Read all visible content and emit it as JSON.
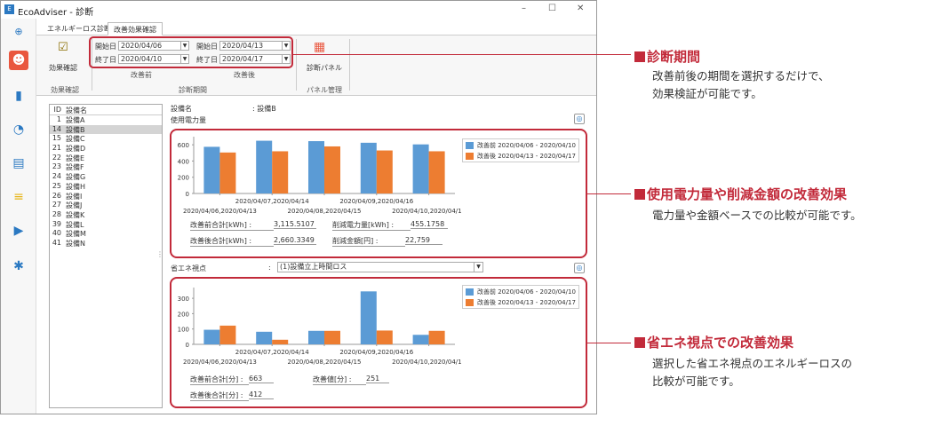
{
  "window": {
    "title": "EcoAdviser - 診断",
    "min": "–",
    "max": "☐",
    "close": "✕"
  },
  "tabs": [
    "エネルギーロス診断",
    "改善効果確認"
  ],
  "ribbon": {
    "effect_label": "効果確認",
    "effect_group": "効果確認",
    "before": {
      "start_label": "開始日",
      "start": "2020/04/06",
      "end_label": "終了日",
      "end": "2020/04/10",
      "caption": "改善前"
    },
    "after": {
      "start_label": "開始日",
      "start": "2020/04/13",
      "end_label": "終了日",
      "end": "2020/04/17",
      "caption": "改善後"
    },
    "period_group": "診断期間",
    "panel_label": "診断パネル",
    "panel_group": "パネル管理"
  },
  "list": {
    "headers": [
      "ID",
      "設備名"
    ],
    "rows": [
      [
        "1",
        "設備A"
      ],
      [
        "14",
        "設備B"
      ],
      [
        "15",
        "設備C"
      ],
      [
        "21",
        "設備D"
      ],
      [
        "22",
        "設備E"
      ],
      [
        "23",
        "設備F"
      ],
      [
        "24",
        "設備G"
      ],
      [
        "25",
        "設備H"
      ],
      [
        "26",
        "設備I"
      ],
      [
        "27",
        "設備J"
      ],
      [
        "28",
        "設備K"
      ],
      [
        "39",
        "設備L"
      ],
      [
        "40",
        "設備M"
      ],
      [
        "41",
        "設備N"
      ]
    ],
    "selected_index": 1
  },
  "detail": {
    "equip_label": "設備名",
    "equip_sep": ": 設備B",
    "power_label": "使用電力量",
    "view_label": "省エネ視点",
    "view_sep": ":",
    "view_value": "(1)設備立上時間ロス"
  },
  "legend": {
    "before": "改善前 2020/04/06 - 2020/04/10",
    "after": "改善後 2020/04/13 - 2020/04/17",
    "before_color": "#5b9bd5",
    "after_color": "#ed7d31"
  },
  "chart_data": [
    {
      "type": "bar",
      "categories": [
        "2020/04/06,2020/04/13",
        "2020/04/07,2020/04/14",
        "2020/04/08,2020/04/15",
        "2020/04/09,2020/04/16",
        "2020/04/10,2020/04/17"
      ],
      "series": [
        {
          "name": "改善前 2020/04/06 - 2020/04/10",
          "values": [
            575,
            650,
            645,
            625,
            605
          ]
        },
        {
          "name": "改善後 2020/04/13 - 2020/04/17",
          "values": [
            505,
            520,
            580,
            530,
            520
          ]
        }
      ],
      "ylim": [
        0,
        700
      ],
      "yticks": [
        0,
        200,
        400,
        600
      ]
    },
    {
      "type": "bar",
      "categories": [
        "2020/04/06,2020/04/13",
        "2020/04/07,2020/04/14",
        "2020/04/08,2020/04/15",
        "2020/04/09,2020/04/16",
        "2020/04/10,2020/04/17"
      ],
      "series": [
        {
          "name": "改善前 2020/04/06 - 2020/04/10",
          "values": [
            95,
            82,
            88,
            345,
            62
          ]
        },
        {
          "name": "改善後 2020/04/13 - 2020/04/17",
          "values": [
            122,
            30,
            88,
            90,
            88
          ]
        }
      ],
      "ylim": [
        0,
        370
      ],
      "yticks": [
        0,
        100,
        200,
        300
      ]
    }
  ],
  "summary1": {
    "before_total_label": "改善前合計[kWh] :",
    "before_total": "3,115.5107",
    "after_total_label": "改善後合計[kWh] :",
    "after_total": "2,660.3349",
    "reduce_power_label": "削減電力量[kWh] :",
    "reduce_power": "455.1758",
    "reduce_cost_label": "削減金額[円] :",
    "reduce_cost": "22,759"
  },
  "summary2": {
    "before_total_label": "改善前合計[分] :",
    "before_total": "663",
    "after_total_label": "改善後合計[分] :",
    "after_total": "412",
    "improve_label": "改善値[分] :",
    "improve": "251"
  },
  "callouts": [
    {
      "title": "診断期間",
      "desc": [
        "改善前後の期間を選択するだけで、",
        "効果検証が可能です。"
      ]
    },
    {
      "title": "使用電力量や削減金額の改善効果",
      "desc": [
        "電力量や金額ベースでの比較が可能です。"
      ]
    },
    {
      "title": "省エネ視点での改善効果",
      "desc": [
        "選択した省エネ視点のエネルギーロスの",
        "比較が可能です。"
      ]
    }
  ]
}
